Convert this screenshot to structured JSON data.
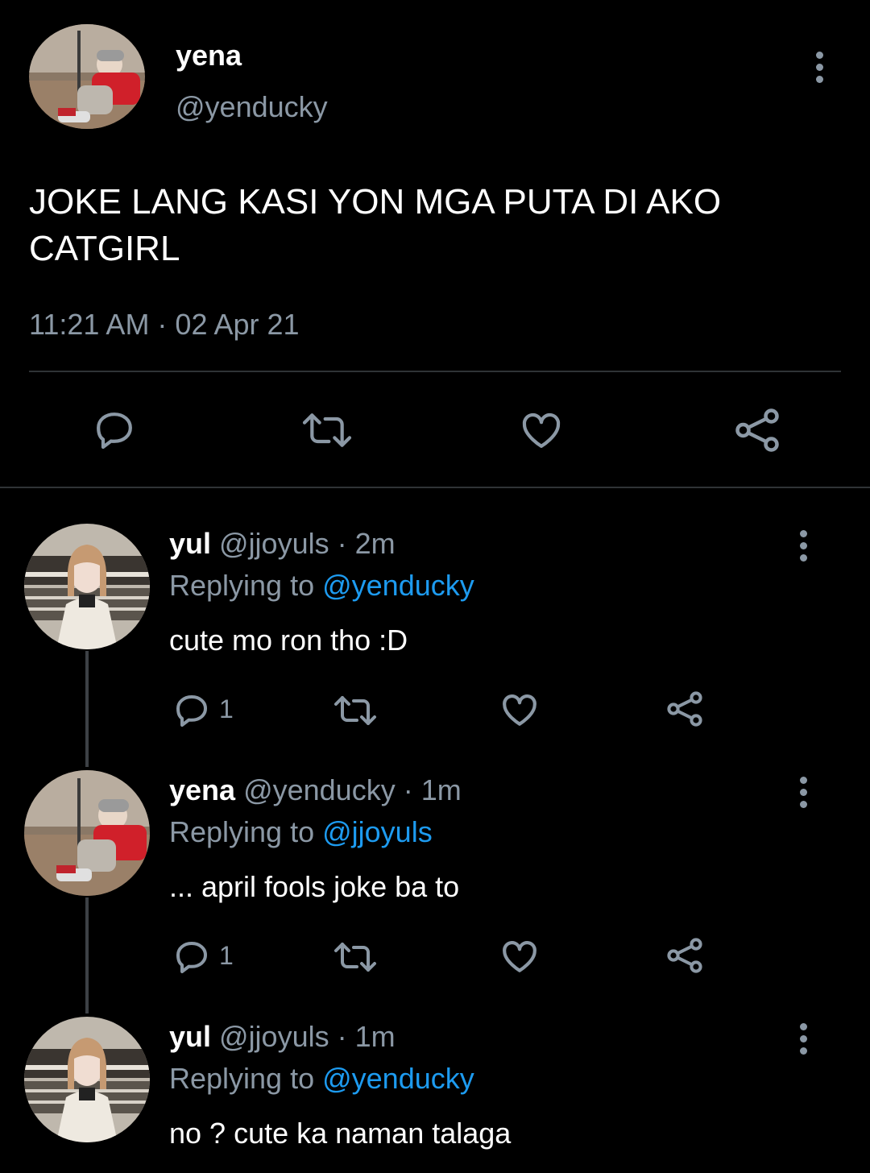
{
  "main_tweet": {
    "name": "yena",
    "handle": "@yenducky",
    "text": "JOKE LANG KASI YON MGA PUTA DI AKO CATGIRL",
    "timestamp": "11:21 AM · 02 Apr 21",
    "actions": [
      "reply-icon",
      "retweet-icon",
      "like-icon",
      "share-icon"
    ]
  },
  "replies": [
    {
      "name": "yul",
      "meta": " @jjoyuls · 2m",
      "replying_prefix": "Replying to ",
      "replying_to": "@yenducky",
      "text": "cute mo ron tho :D",
      "reply_count": "1"
    },
    {
      "name": "yena",
      "meta": " @yenducky · 1m",
      "replying_prefix": "Replying to ",
      "replying_to": "@jjoyuls",
      "text": "... april fools joke ba to",
      "reply_count": "1"
    },
    {
      "name": "yul",
      "meta": " @jjoyuls · 1m",
      "replying_prefix": "Replying to ",
      "replying_to": "@yenducky",
      "text": "no ? cute ka naman talaga"
    }
  ],
  "colors": {
    "background": "#000000",
    "secondary_text": "#8b98a5",
    "mention": "#1d9bf0",
    "divider": "#2f3336"
  }
}
